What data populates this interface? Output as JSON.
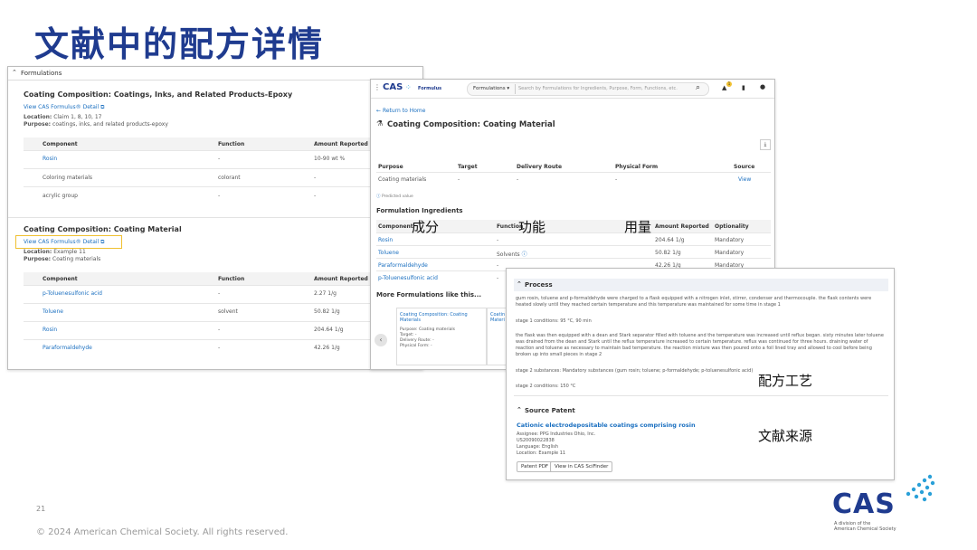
{
  "slide": {
    "title": "文献中的配方详情",
    "page_number": "21",
    "copyright": "© 2024 American Chemical Society. All rights reserved.",
    "brand_logo": "CAS",
    "brand_sub1": "A division of the",
    "brand_sub2": "American Chemical Society"
  },
  "annotations": {
    "component": "成分",
    "function": "功能",
    "amount": "用量",
    "process": "配方工艺",
    "source": "文献来源"
  },
  "left": {
    "section": "Formulations",
    "card1": {
      "title": "Coating Composition: Coatings, Inks, and Related Products-Epoxy",
      "link": "View CAS Formulus® Detail",
      "location_label": "Location:",
      "location": "Claim 1, 8, 10, 17",
      "purpose_label": "Purpose:",
      "purpose": "coatings, inks, and related products-epoxy",
      "headers": [
        "Component",
        "Function",
        "Amount Reported"
      ],
      "rows": [
        [
          "Rosin",
          "-",
          "10-90 wt %"
        ],
        [
          "Coloring materials",
          "colorant",
          "-"
        ],
        [
          "acrylic group",
          "-",
          "-"
        ]
      ]
    },
    "card2": {
      "title": "Coating Composition: Coating Material",
      "link": "View CAS Formulus® Detail",
      "location_label": "Location:",
      "location": "Example 11",
      "purpose_label": "Purpose:",
      "purpose": "Coating materials",
      "headers": [
        "Component",
        "Function",
        "Amount Reported"
      ],
      "rows": [
        [
          "p-Toluenesulfonic acid",
          "-",
          "2.27 1/g"
        ],
        [
          "Toluene",
          "solvent",
          "50.82 1/g"
        ],
        [
          "Rosin",
          "-",
          "204.64 1/g"
        ],
        [
          "Paraformaldehyde",
          "-",
          "42.26 1/g"
        ]
      ]
    }
  },
  "middle": {
    "logo": "CAS",
    "product": "Formulus",
    "dropdown": "Formulations",
    "search_placeholder": "Search by Formulations for Ingredients, Purpose, Form, Functions, etc.",
    "notification_count": "1",
    "back": "Return to Home",
    "title": "Coating Composition: Coating Material",
    "purpose_headers": [
      "Purpose",
      "Target",
      "Delivery Route",
      "Physical Form",
      "Source"
    ],
    "purpose_row": [
      "Coating materials",
      "-",
      "-",
      "-",
      "View"
    ],
    "predicted_note": "Predicted value",
    "ingredients_title": "Formulation Ingredients",
    "ing_headers": [
      "Component",
      "Function",
      "Amount Reported",
      "Optionality"
    ],
    "ing_rows": [
      [
        "Rosin",
        "-",
        "204.64 1/g",
        "Mandatory"
      ],
      [
        "Toluene",
        "Solvents",
        "50.82 1/g",
        "Mandatory"
      ],
      [
        "Paraformaldehyde",
        "-",
        "42.26 1/g",
        "Mandatory"
      ],
      [
        "p-Toluenesulfonic acid",
        "-",
        "",
        ""
      ]
    ],
    "more_title": "More Formulations like this...",
    "more_card": {
      "title": "Coating Composition: Coating Materials",
      "purpose": "Purpose: Coating materials",
      "target": "Target: -",
      "route": "Delivery Route: -",
      "form": "Physical Form: -"
    },
    "more_card2_title": "Coatin Materi"
  },
  "right": {
    "process_title": "Process",
    "p1": "gum rosin, toluene and p-formaldehyde were charged to a flask equipped with a nitrogen inlet, stirrer, condenser and thermocouple. the flask contents were heated slowly until they reached certain temperature and this temperature was maintained for some time in stage 1",
    "p2": "stage 1 conditions: 95 °C, 90 min",
    "p3": "the flask was then equipped with a dean and Stark separator filled with toluene and the temperature was increased until reflux began. sixty minutes later toluene was drained from the dean and Stark until the reflux temperature increased to certain temperature. reflux was continued for three hours. draining water of reaction and toluene as necessary to maintain bad temperature. the reaction mixture was then poured onto a foil lined tray and allowed to cool before being broken up into small pieces in stage 2",
    "p4": "stage 2 substances: Mandatory substances (gum rosin; toluene; p-formaldehyde; p-toluenesulfonic acid)",
    "p5": "stage 2 conditions: 150 °C",
    "source_title": "Source Patent",
    "patent_title": "Cationic electrodepositable coatings comprising rosin",
    "assignee": "Assignee: PPG Industries Ohio, Inc.",
    "patent_no": "US20090022838",
    "language": "Language: English",
    "location": "Location: Example 11",
    "btn_pdf": "Patent PDF",
    "btn_view": "View in CAS SciFinder"
  }
}
